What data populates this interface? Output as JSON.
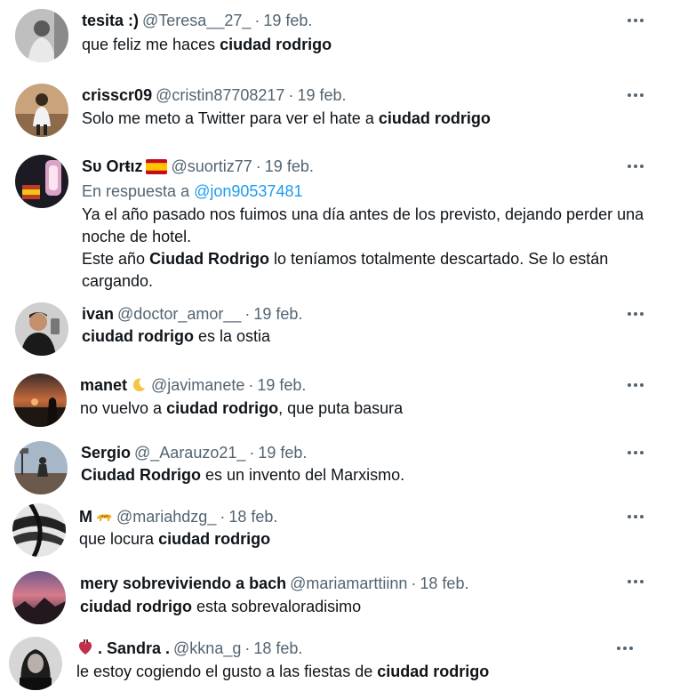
{
  "tweets": [
    {
      "name": "tesita :)",
      "handle": "@Teresa__27_",
      "date": "19 feb.",
      "text_pre": "que feliz me haces ",
      "text_bold": "ciudad rodrigo",
      "text_post": ""
    },
    {
      "name": "crisscr09",
      "handle": "@cristin87708217",
      "date": "19 feb.",
      "text_pre": "Solo me meto a Twitter para ver el hate a ",
      "text_bold": "ciudad rodrigo",
      "text_post": ""
    },
    {
      "name": "Sυ Orŧιz",
      "handle": "@suortiz77",
      "date": "19 feb.",
      "reply_prefix": "En respuesta a",
      "reply_mention": "@jon90537481",
      "line1": "Ya el año pasado nos fuimos una día antes de los previsto, dejando perder una noche de hotel.",
      "line2_pre": "Este año ",
      "line2_bold": "Ciudad Rodrigo",
      "line2_post": " lo teníamos totalmente descartado. Se lo están cargando."
    },
    {
      "name": "ivan",
      "handle": "@doctor_amor__",
      "date": "19 feb.",
      "text_pre": "",
      "text_bold": "ciudad rodrigo",
      "text_post": " es la ostia"
    },
    {
      "name": "manet",
      "handle": "@javimanete",
      "date": "19 feb.",
      "text_pre": "no vuelvo a ",
      "text_bold": "ciudad rodrigo",
      "text_post": ", que puta basura"
    },
    {
      "name": "Sergio",
      "handle": "@_Aarauzo21_",
      "date": "19 feb.",
      "text_pre": "",
      "text_bold": "Ciudad Rodrigo",
      "text_post": " es un invento del Marxismo."
    },
    {
      "name": "M",
      "handle": "@mariahdzg_",
      "date": "18 feb.",
      "text_pre": "que locura ",
      "text_bold": "ciudad rodrigo",
      "text_post": ""
    },
    {
      "name": "mery sobreviviendo a bach",
      "handle": "@mariamarttiinn",
      "date": "18 feb.",
      "text_pre": "",
      "text_bold": "ciudad rodrigo",
      "text_post": " esta sobrevaloradisimo"
    },
    {
      "name": ". Sandra .",
      "handle": "@kkna_g",
      "date": "18 feb.",
      "text_pre": "le estoy cogiendo el gusto a las fiestas de ",
      "text_bold": "ciudad rodrigo",
      "text_post": ""
    }
  ],
  "separator": "·",
  "icons": {
    "more": "more-horizontal-icon",
    "flag": "spain-flag-emoji",
    "moon": "crescent-moon-emoji",
    "leopard": "leopard-emoji",
    "heart": "anatomical-heart-emoji"
  },
  "colors": {
    "text": "#0f1419",
    "secondary": "#536471",
    "link": "#1d9bf0"
  }
}
